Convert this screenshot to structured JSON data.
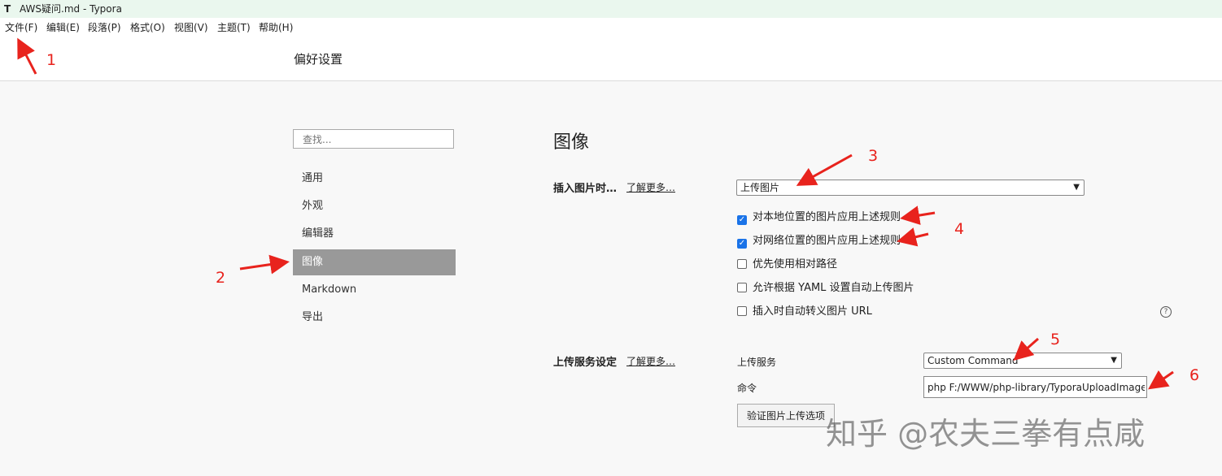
{
  "window": {
    "app_icon": "T",
    "title": "AWS疑问.md - Typora"
  },
  "menu": [
    "文件(F)",
    "编辑(E)",
    "段落(P)",
    "格式(O)",
    "视图(V)",
    "主题(T)",
    "帮助(H)"
  ],
  "preferences": {
    "title": "偏好设置",
    "search_placeholder": "查找...",
    "nav": [
      {
        "label": "通用",
        "active": false
      },
      {
        "label": "外观",
        "active": false
      },
      {
        "label": "编辑器",
        "active": false
      },
      {
        "label": "图像",
        "active": true
      },
      {
        "label": "Markdown",
        "active": false
      },
      {
        "label": "导出",
        "active": false
      }
    ]
  },
  "image_section": {
    "heading": "图像",
    "insert": {
      "label": "插入图片时…",
      "learn_more": "了解更多…",
      "selected": "上传图片",
      "options": [
        {
          "label": "对本地位置的图片应用上述规则",
          "checked": true
        },
        {
          "label": "对网络位置的图片应用上述规则",
          "checked": true
        },
        {
          "label": "优先使用相对路径",
          "checked": false
        },
        {
          "label": "允许根据 YAML 设置自动上传图片",
          "checked": false
        },
        {
          "label": "插入时自动转义图片 URL",
          "checked": false
        }
      ]
    },
    "upload": {
      "label": "上传服务设定",
      "learn_more": "了解更多…",
      "service_label": "上传服务",
      "service_selected": "Custom Command",
      "command_label": "命令",
      "command_value": "php F:/WWW/php-library/TyporaUploadImage.php",
      "verify_button": "验证图片上传选项"
    },
    "help_icon": "question-circle-icon"
  },
  "annotations": [
    "1",
    "2",
    "3",
    "4",
    "5",
    "6"
  ],
  "watermark": "知乎 @农夫三拳有点咸",
  "colors": {
    "titlebar": "#eaf7ee",
    "active_nav": "#999999",
    "arrow": "#e8231d",
    "checkbox": "#1a73e8"
  }
}
